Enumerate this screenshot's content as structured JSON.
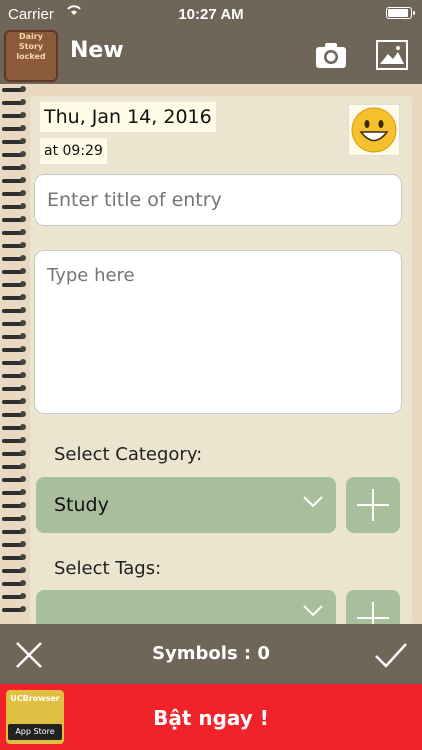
{
  "status": {
    "carrier": "Carrier",
    "time": "10:27 AM"
  },
  "nav": {
    "title": "New",
    "logo_lines": [
      "Dairy",
      "Story",
      "locked"
    ]
  },
  "entry": {
    "date": "Thu, Jan 14, 2016",
    "time": "at 09:29",
    "title_placeholder": "Enter title of entry",
    "body_placeholder": "Type here"
  },
  "category": {
    "label": "Select Category:",
    "value": "Study"
  },
  "tags": {
    "label": "Select Tags:",
    "value": ""
  },
  "toolbar": {
    "symbols": "Symbols : 0"
  },
  "ad": {
    "brand": "UCBrowser",
    "store": "App Store",
    "cta": "Bật ngay !"
  },
  "colors": {
    "bar": "#6f6559",
    "accent_green": "#a9bf9c",
    "ad_red": "#f0232b",
    "paper": "#ebe5cf"
  }
}
